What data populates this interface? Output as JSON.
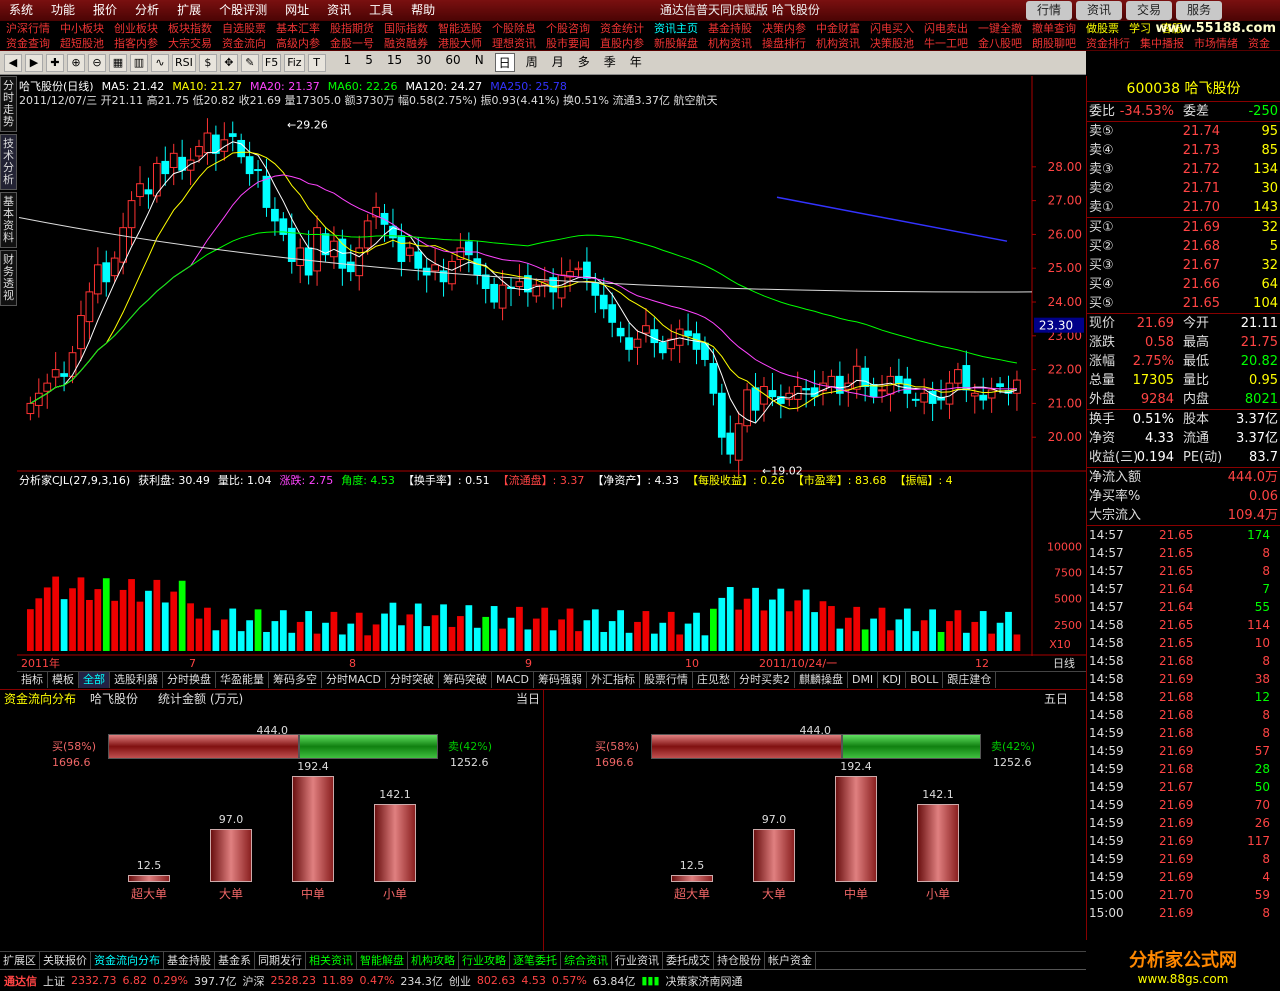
{
  "menubar": {
    "items": [
      "系统",
      "功能",
      "报价",
      "分析",
      "扩展",
      "个股评测",
      "网址",
      "资讯",
      "工具",
      "帮助"
    ],
    "window_title": "通达信普天同庆赋版  哈飞股份",
    "modes": [
      "行情",
      "资讯",
      "交易",
      "服务"
    ]
  },
  "navrow1": [
    "沪深行情",
    "中小板块",
    "创业板块",
    "板块指数",
    "自选股票",
    "基本汇率",
    "股指期货",
    "国际指数",
    "智能选股",
    "个股除息",
    "个股咨询",
    "资金统计",
    "资讯主页",
    "基金持股",
    "决策内参",
    "中金财富",
    "闪电买入",
    "闪电卖出",
    "一键全撤",
    "撤单查询",
    "做股票",
    "学习",
    "客服"
  ],
  "navrow2": [
    "资金查询",
    "超短股池",
    "指客内参",
    "大宗交易",
    "资金流向",
    "高级内参",
    "金股一号",
    "融资融券",
    "港股大师",
    "理想资讯",
    "股市要闻",
    "直股内参",
    "新股解盘",
    "机构资讯",
    "操盘排行",
    "机构资讯",
    "决策股池",
    "牛一工吧",
    "金八股吧",
    "朗股聊吧",
    "资金排行",
    "集中播报",
    "市场情绪",
    "资金"
  ],
  "nav_logo": "www.55188.com",
  "toolbar": {
    "periods": [
      "1",
      "5",
      "15",
      "30",
      "60",
      "N",
      "日",
      "周",
      "月",
      "多",
      "季",
      "年"
    ],
    "active_period": "日",
    "tools": [
      "RSI",
      "F5",
      "Fiz"
    ]
  },
  "left_tabs": [
    "分时走势",
    "技术分析",
    "基本资料",
    "财务透视"
  ],
  "legend": {
    "line1": [
      {
        "t": "哈飞股份(日线)",
        "c": "white"
      },
      {
        "t": "MA5: 21.42",
        "c": "white"
      },
      {
        "t": "MA10: 21.27",
        "c": "yellow"
      },
      {
        "t": "MA20: 21.37",
        "c": "mag"
      },
      {
        "t": "MA60: 22.26",
        "c": "green"
      },
      {
        "t": "MA120: 24.27",
        "c": "white"
      },
      {
        "t": "MA250: 25.78",
        "c": "blue"
      }
    ],
    "line2": "2011/12/07/三  开21.11  高21.75  低20.82  收21.69  量17305.0  额3730万  幅0.58(2.75%)  振0.93(4.41%)  换0.51%  流通3.37亿  航空航天",
    "sub": [
      {
        "t": "分析家CJL(27,9,3,16)",
        "c": "white"
      },
      {
        "t": "获利盘: 30.49",
        "c": "white"
      },
      {
        "t": "量比: 1.04",
        "c": "white"
      },
      {
        "t": "涨跌: 2.75",
        "c": "mag"
      },
      {
        "t": "角度: 4.53",
        "c": "green"
      },
      {
        "t": "【换手率】: 0.51",
        "c": "white"
      },
      {
        "t": "【流通盘】: 3.37",
        "c": "red"
      },
      {
        "t": "【净资产】: 4.33",
        "c": "white"
      },
      {
        "t": "【每股收益】: 0.26",
        "c": "yellow"
      },
      {
        "t": "【市盈率】: 83.68",
        "c": "yellow"
      },
      {
        "t": "【振幅】: 4",
        "c": "yellow"
      }
    ]
  },
  "price_axis": [
    "28.00",
    "27.00",
    "26.00",
    "25.00",
    "24.00",
    "23.00",
    "22.00",
    "21.00",
    "20.00"
  ],
  "price_marker": "23.30",
  "vol_axis": [
    "10000",
    "7500",
    "5000",
    "2500"
  ],
  "vol_unit": "X10",
  "annotations": {
    "high": "29.26",
    "low": "19.02"
  },
  "date_axis": [
    "2011年",
    "7",
    "8",
    "9",
    "10",
    "2011/10/24/一",
    "12"
  ],
  "date_mode": "日线",
  "chart_data": {
    "type": "candlestick",
    "title": "哈飞股份(日线)",
    "ylim": [
      19.0,
      29.8
    ],
    "ma": {
      "MA5": 21.42,
      "MA10": 21.27,
      "MA20": 21.37,
      "MA60": 22.26,
      "MA120": 24.27,
      "MA250": 25.78
    },
    "high": 29.26,
    "low": 19.02,
    "last": {
      "open": 21.11,
      "high": 21.75,
      "low": 20.82,
      "close": 21.69,
      "volume": 17305.0
    }
  },
  "indicator_tabs": [
    "指标",
    "模板",
    "全部",
    "选股利器",
    "分时换盘",
    "华盈能量",
    "筹码多空",
    "分时MACD",
    "分时突破",
    "筹码突破",
    "MACD",
    "筹码强弱",
    "外汇指标",
    "股票行情",
    "庄见愁",
    "分时买卖2",
    "麒麟操盘",
    "DMI",
    "KDJ",
    "BOLL",
    "跟庄建仓"
  ],
  "flow": {
    "title": "资金流向分布",
    "stock": "哈飞股份",
    "unit": "统计金额 (万元)",
    "left_period": "当日",
    "right_period": "五日",
    "total": "444.0",
    "buy_label": "买(58%)",
    "buy_value": "1696.6",
    "sell_label": "卖(42%)",
    "sell_value": "1252.6",
    "buy_frac": 0.58,
    "cats": [
      {
        "name": "超大单",
        "value": "12.5",
        "num": 12.5
      },
      {
        "name": "大单",
        "value": "97.0",
        "num": 97.0
      },
      {
        "name": "中单",
        "value": "192.4",
        "num": 192.4
      },
      {
        "name": "小单",
        "value": "142.1",
        "num": 142.1
      }
    ]
  },
  "bottom_tabs": [
    "扩展区",
    "关联报价",
    "资金流向分布",
    "基金持股",
    "基金系",
    "同期发行",
    "相关资讯",
    "智能解盘",
    "机构攻略",
    "行业攻略",
    "逐笔委托",
    "综合资讯",
    "行业资讯",
    "委托成交",
    "持仓股份",
    "帐户资金"
  ],
  "status": {
    "app": "通达信",
    "sh_label": "上证",
    "sh": "2332.73",
    "sh_chg": "6.82",
    "sh_pct": "0.29%",
    "sh_amt": "397.7亿",
    "hs_label": "沪深",
    "hs": "2528.23",
    "hs_chg": "11.89",
    "hs_pct": "0.47%",
    "hs_amt": "234.3亿",
    "cy_label": "创业",
    "cy": "802.63",
    "cy_chg": "4.53",
    "cy_pct": "0.57%",
    "cy_amt": "63.84亿",
    "site": "决策家济南网通"
  },
  "quote": {
    "code_name": "600038 哈飞股份",
    "webi": {
      "k": "委比",
      "v": "-34.53%",
      "k2": "委差",
      "v2": "-250"
    },
    "sells": [
      {
        "k": "卖⑤",
        "p": "21.74",
        "q": "95"
      },
      {
        "k": "卖④",
        "p": "21.73",
        "q": "85"
      },
      {
        "k": "卖③",
        "p": "21.72",
        "q": "134"
      },
      {
        "k": "卖②",
        "p": "21.71",
        "q": "30"
      },
      {
        "k": "卖①",
        "p": "21.70",
        "q": "143"
      }
    ],
    "buys": [
      {
        "k": "买①",
        "p": "21.69",
        "q": "32"
      },
      {
        "k": "买②",
        "p": "21.68",
        "q": "5"
      },
      {
        "k": "买③",
        "p": "21.67",
        "q": "32"
      },
      {
        "k": "买④",
        "p": "21.66",
        "q": "64"
      },
      {
        "k": "买⑤",
        "p": "21.65",
        "q": "104"
      }
    ],
    "stats": [
      {
        "k": "现价",
        "v": "21.69",
        "vc": "red",
        "k2": "今开",
        "v2": "21.11",
        "v2c": "white"
      },
      {
        "k": "涨跌",
        "v": "0.58",
        "vc": "red",
        "k2": "最高",
        "v2": "21.75",
        "v2c": "red"
      },
      {
        "k": "涨幅",
        "v": "2.75%",
        "vc": "red",
        "k2": "最低",
        "v2": "20.82",
        "v2c": "green"
      },
      {
        "k": "总量",
        "v": "17305",
        "vc": "yellow",
        "k2": "量比",
        "v2": "0.95",
        "v2c": "yellow"
      },
      {
        "k": "外盘",
        "v": "9284",
        "vc": "red",
        "k2": "内盘",
        "v2": "8021",
        "v2c": "green"
      }
    ],
    "stats2": [
      {
        "k": "换手",
        "v": "0.51%",
        "vc": "white",
        "k2": "股本",
        "v2": "3.37亿",
        "v2c": "white"
      },
      {
        "k": "净资",
        "v": "4.33",
        "vc": "white",
        "k2": "流通",
        "v2": "3.37亿",
        "v2c": "white"
      },
      {
        "k": "收益(三)",
        "v": "0.194",
        "vc": "white",
        "k2": "PE(动)",
        "v2": "83.7",
        "v2c": "white"
      }
    ],
    "flows": [
      {
        "k": "净流入额",
        "v": "444.0万"
      },
      {
        "k": "净买率%",
        "v": "0.06"
      },
      {
        "k": "大宗流入",
        "v": "109.4万"
      }
    ],
    "ticks": [
      {
        "t": "14:57",
        "p": "21.65",
        "v": "174",
        "c": "green"
      },
      {
        "t": "14:57",
        "p": "21.65",
        "v": "8",
        "c": "red"
      },
      {
        "t": "14:57",
        "p": "21.65",
        "v": "8",
        "c": "red"
      },
      {
        "t": "14:57",
        "p": "21.64",
        "v": "7",
        "c": "green"
      },
      {
        "t": "14:57",
        "p": "21.64",
        "v": "55",
        "c": "green"
      },
      {
        "t": "14:58",
        "p": "21.65",
        "v": "114",
        "c": "red"
      },
      {
        "t": "14:58",
        "p": "21.65",
        "v": "10",
        "c": "red"
      },
      {
        "t": "14:58",
        "p": "21.68",
        "v": "8",
        "c": "red"
      },
      {
        "t": "14:58",
        "p": "21.69",
        "v": "38",
        "c": "red"
      },
      {
        "t": "14:58",
        "p": "21.68",
        "v": "12",
        "c": "green"
      },
      {
        "t": "14:58",
        "p": "21.68",
        "v": "8",
        "c": "red"
      },
      {
        "t": "14:59",
        "p": "21.68",
        "v": "8",
        "c": "red"
      },
      {
        "t": "14:59",
        "p": "21.69",
        "v": "57",
        "c": "red"
      },
      {
        "t": "14:59",
        "p": "21.68",
        "v": "28",
        "c": "green"
      },
      {
        "t": "14:59",
        "p": "21.67",
        "v": "50",
        "c": "green"
      },
      {
        "t": "14:59",
        "p": "21.69",
        "v": "70",
        "c": "red"
      },
      {
        "t": "14:59",
        "p": "21.69",
        "v": "26",
        "c": "red"
      },
      {
        "t": "14:59",
        "p": "21.69",
        "v": "117",
        "c": "red"
      },
      {
        "t": "14:59",
        "p": "21.69",
        "v": "8",
        "c": "red"
      },
      {
        "t": "14:59",
        "p": "21.69",
        "v": "4",
        "c": "red"
      },
      {
        "t": "15:00",
        "p": "21.70",
        "v": "59",
        "c": "red"
      },
      {
        "t": "15:00",
        "p": "21.69",
        "v": "8",
        "c": "red"
      }
    ]
  },
  "brand": {
    "name": "分析家公式网",
    "url": "www.88gs.com"
  }
}
